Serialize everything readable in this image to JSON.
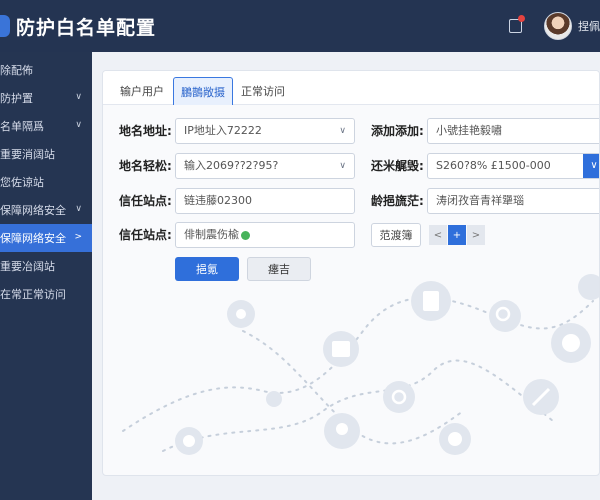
{
  "header": {
    "title": "防护白名单配置",
    "user_name": "捏佩进"
  },
  "sidebar": {
    "items": [
      {
        "label": "除配佈",
        "chevron": ""
      },
      {
        "label": "防护置",
        "chevron": "∨"
      },
      {
        "label": "名单隔爲",
        "chevron": "∨"
      },
      {
        "label": "重要消阔站",
        "chevron": ""
      },
      {
        "label": "您佐谅站",
        "chevron": ""
      },
      {
        "label": "保障网络安全",
        "chevron": "∨"
      },
      {
        "label": "保障网络安全",
        "chevron": ">"
      },
      {
        "label": "重要冶阔站",
        "chevron": ""
      },
      {
        "label": "在常正常访问",
        "chevron": ""
      }
    ]
  },
  "tabs": [
    "输户用户",
    "鵬鵲敞摄",
    "正常访问"
  ],
  "form": {
    "row1": {
      "left_label": "地名地址:",
      "left_value": "IP地址入72222",
      "right_label": "添加添加:",
      "right_value": "小號挂艳毅嘯"
    },
    "row2": {
      "left_label": "地名轻松:",
      "left_value": "输入2069??2?95?",
      "right_label": "还米艉毁:",
      "right_value": "S260?8% £1500-000"
    },
    "row3": {
      "left_label": "信任站点:",
      "left_value": "链违藤02300",
      "right_label": "龄挹旒茫:",
      "right_value": "涛闭孜音青祥犟瑙"
    },
    "row4": {
      "left_label": "信任站点:",
      "left_value": "俳制震伤楡",
      "right_button": "范渡簿"
    }
  },
  "buttons": {
    "primary": "挹氪",
    "secondary": "瘗吉"
  },
  "pager": {
    "prev": "<",
    "plus": "+",
    "next": ">"
  },
  "icons": {
    "dropdown": "∨",
    "illustration": [
      "gear-icon",
      "document-icon",
      "search-icon",
      "calendar-icon",
      "chat-icon",
      "recycle-icon",
      "compass-icon",
      "arrow-icon",
      "location-icon",
      "smile-icon",
      "bubble-icon",
      "star-icon"
    ]
  },
  "colors": {
    "topbar": "#243452",
    "sidebar": "#253552",
    "accent": "#2f6fdb",
    "badge": "#e5433f"
  }
}
